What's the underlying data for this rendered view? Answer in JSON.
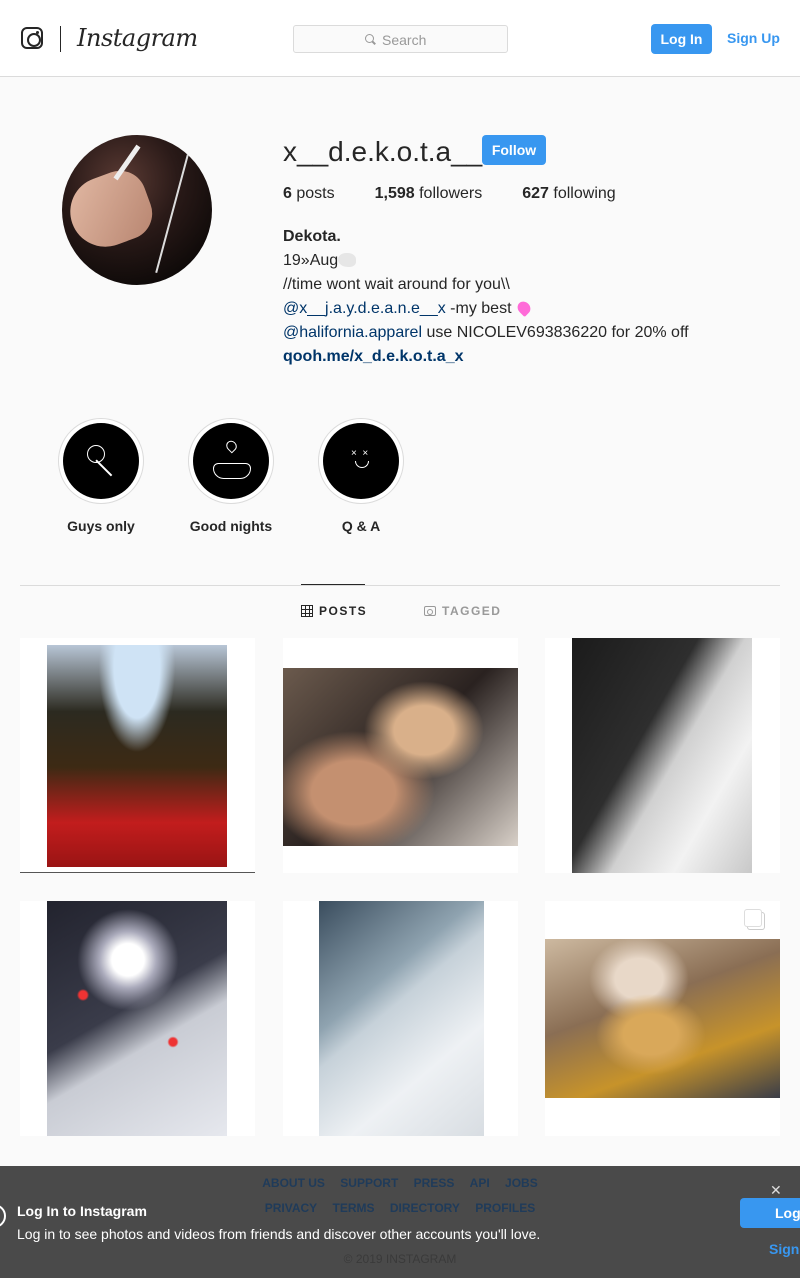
{
  "header": {
    "brand": "Instagram",
    "search_placeholder": "Search",
    "login_label": "Log In",
    "signup_label": "Sign Up"
  },
  "profile": {
    "username": "x__d.e.k.o.t.a__x",
    "follow_label": "Follow",
    "stats": [
      {
        "count": "6",
        "label": "posts"
      },
      {
        "count": "1,598",
        "label": "followers"
      },
      {
        "count": "627",
        "label": "following"
      }
    ],
    "bio": {
      "name": "Dekota.",
      "line1": "19»Aug",
      "line2": "//time wont wait around for you\\\\",
      "line3_mention": "@x__j.a.y.d.e.a.n.e__x",
      "line3_rest": " -my best ",
      "line4_mention": "@halifornia.apparel",
      "line4_rest": " use NICOLEV693836220 for 20% off",
      "external_link": "qooh.me/x_d.e.k.o.t.a_x"
    }
  },
  "highlights": [
    {
      "label": "Guys only",
      "icon": "rose-icon"
    },
    {
      "label": "Good nights",
      "icon": "hands-icon"
    },
    {
      "label": "Q & A",
      "icon": "smiley-icon"
    }
  ],
  "tabs": {
    "posts": "POSTS",
    "tagged": "TAGGED"
  },
  "posts": [
    {
      "icon": "photo"
    },
    {
      "icon": "photo"
    },
    {
      "icon": "photo"
    },
    {
      "icon": "photo"
    },
    {
      "icon": "photo"
    },
    {
      "icon": "photo",
      "multi": true
    }
  ],
  "footer": {
    "links_row1": [
      "ABOUT US",
      "SUPPORT",
      "PRESS",
      "API",
      "JOBS"
    ],
    "links_row2": [
      "PRIVACY",
      "TERMS",
      "DIRECTORY",
      "PROFILES"
    ],
    "copyright": "© 2019 INSTAGRAM"
  },
  "login_banner": {
    "title": "Log In to Instagram",
    "text": "Log in to see photos and videos from friends and discover other accounts you'll love.",
    "login_label": "Log",
    "signup_label": "Sign"
  },
  "colors": {
    "accent": "#3897f0",
    "text": "#262626",
    "link": "#003569",
    "background": "#fafafa"
  }
}
